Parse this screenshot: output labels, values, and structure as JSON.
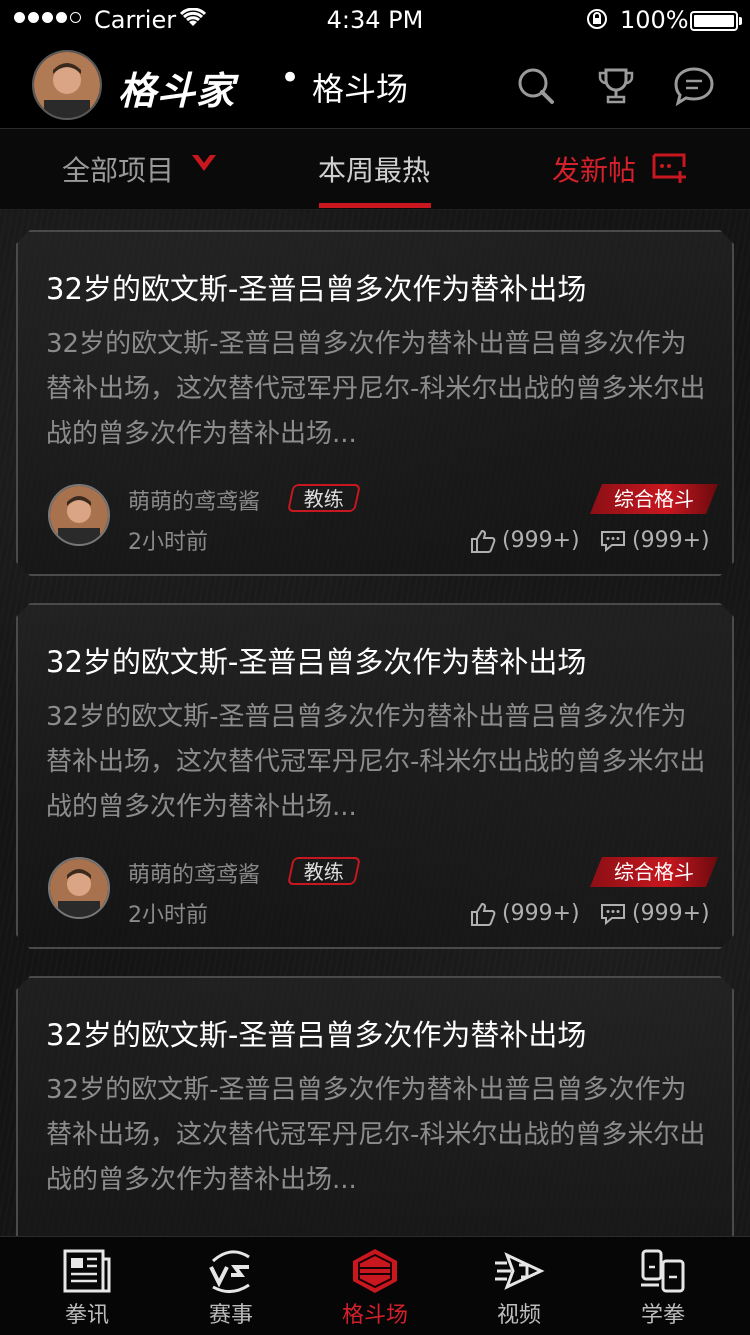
{
  "status_bar": {
    "carrier": "Carrier",
    "time": "4:34 PM",
    "battery": "100%"
  },
  "header": {
    "brand": "格斗家",
    "separator": "•",
    "section": "格斗场"
  },
  "tabs": {
    "all": "全部项目",
    "hot": "本周最热",
    "new_post": "发新帖"
  },
  "posts": [
    {
      "title": "32岁的欧文斯-圣普吕曾多次作为替补出场",
      "excerpt": "32岁的欧文斯-圣普吕曾多次作为替补出普吕曾多次作为替补出场，这次替代冠军丹尼尔-科米尔出战的曾多米尔出战的曾多次作为替补出场...",
      "author": "萌萌的鸢鸢酱",
      "role": "教练",
      "time": "2小时前",
      "category": "综合格斗",
      "likes": "(999+)",
      "comments": "(999+)"
    },
    {
      "title": "32岁的欧文斯-圣普吕曾多次作为替补出场",
      "excerpt": "32岁的欧文斯-圣普吕曾多次作为替补出普吕曾多次作为替补出场，这次替代冠军丹尼尔-科米尔出战的曾多米尔出战的曾多次作为替补出场...",
      "author": "萌萌的鸢鸢酱",
      "role": "教练",
      "time": "2小时前",
      "category": "综合格斗",
      "likes": "(999+)",
      "comments": "(999+)"
    },
    {
      "title": "32岁的欧文斯-圣普吕曾多次作为替补出场",
      "excerpt": "32岁的欧文斯-圣普吕曾多次作为替补出普吕曾多次作为替补出场，这次替代冠军丹尼尔-科米尔出战的曾多米尔出战的曾多次作为替补出场..."
    }
  ],
  "tabbar": {
    "items": [
      {
        "label": "拳讯",
        "icon": "news-icon"
      },
      {
        "label": "赛事",
        "icon": "vs-icon"
      },
      {
        "label": "格斗场",
        "icon": "ring-icon"
      },
      {
        "label": "视频",
        "icon": "video-icon"
      },
      {
        "label": "学拳",
        "icon": "learn-icon"
      }
    ],
    "active_index": 2
  },
  "colors": {
    "accent": "#c8171f",
    "background": "#141414",
    "text_muted": "#8c8c8c"
  }
}
